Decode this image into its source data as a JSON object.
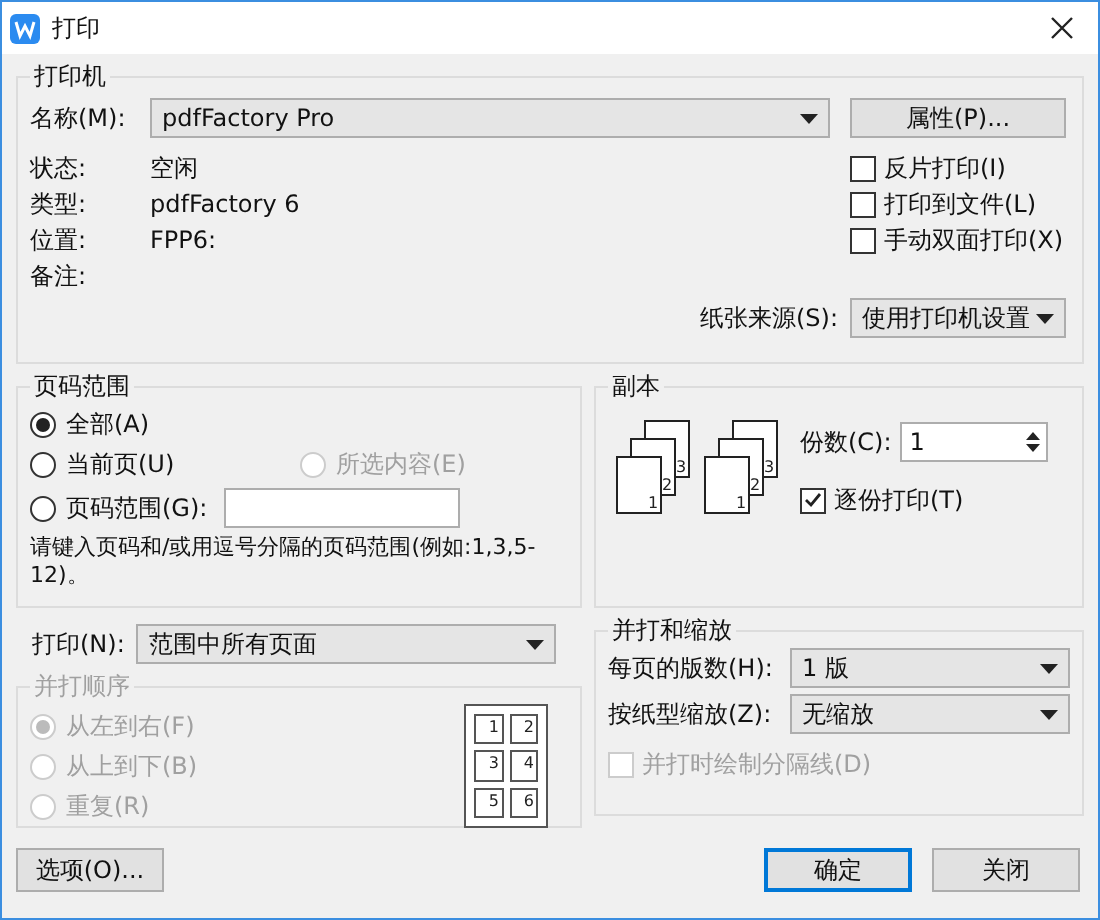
{
  "window": {
    "title": "打印"
  },
  "printer": {
    "title": "打印机",
    "name_label": "名称(M):",
    "name_value": "pdfFactory Pro",
    "properties_button": "属性(P)...",
    "info": [
      {
        "label": "状态:",
        "value": "空闲"
      },
      {
        "label": "类型:",
        "value": "pdfFactory 6"
      },
      {
        "label": "位置:",
        "value": "FPP6:"
      },
      {
        "label": "备注:"
      }
    ],
    "options": [
      {
        "label": "反片打印(I)",
        "checked": false
      },
      {
        "label": "打印到文件(L)",
        "checked": false
      },
      {
        "label": "手动双面打印(X)",
        "checked": false
      }
    ],
    "paper_source": {
      "label": "纸张来源(S):",
      "value": "使用打印机设置"
    }
  },
  "page_range": {
    "title": "页码范围",
    "options": [
      {
        "label": "全部(A)",
        "selected": true,
        "disabled": false
      },
      {
        "label": "当前页(U)",
        "selected": false,
        "disabled": false
      },
      {
        "label": "所选内容(E)",
        "selected": false,
        "disabled": true
      },
      {
        "label": "页码范围(G):",
        "selected": false,
        "disabled": false
      }
    ],
    "hint": "请键入页码和/或用逗号分隔的页码范围(例如:1,3,5-12)。"
  },
  "copies": {
    "title": "副本",
    "stacks": [
      {
        "pages": [
          "1",
          "2",
          "3"
        ]
      },
      {
        "pages": [
          "1",
          "2",
          "3"
        ]
      }
    ],
    "count_label": "份数(C):",
    "count_value": "1",
    "collate": {
      "label": "逐份打印(T)",
      "checked": true
    }
  },
  "print_what": {
    "label": "打印(N):",
    "value": "范围中所有页面"
  },
  "order": {
    "title": "并打顺序",
    "disabled": true,
    "options": [
      {
        "label": "从左到右(F)",
        "selected": true
      },
      {
        "label": "从上到下(B)",
        "selected": false
      },
      {
        "label": "重复(R)",
        "selected": false
      }
    ],
    "preview_pages": [
      "1",
      "2",
      "3",
      "4",
      "5",
      "6"
    ]
  },
  "zoom": {
    "title": "并打和缩放",
    "pages_per_sheet": {
      "label": "每页的版数(H):",
      "value": "1 版"
    },
    "scale": {
      "label": "按纸型缩放(Z):",
      "value": "无缩放"
    },
    "borders": {
      "label": "并打时绘制分隔线(D)",
      "checked": false,
      "disabled": true
    }
  },
  "buttons": [
    {
      "label": "选项(O)...",
      "kind": "options"
    },
    {
      "label": "确定",
      "kind": "default"
    },
    {
      "label": "关闭",
      "kind": "normal"
    }
  ]
}
